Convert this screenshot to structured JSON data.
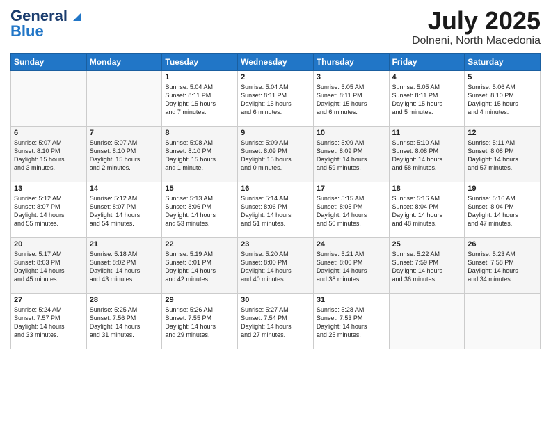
{
  "header": {
    "logo_line1": "General",
    "logo_line2": "Blue",
    "month_year": "July 2025",
    "location": "Dolneni, North Macedonia"
  },
  "days_of_week": [
    "Sunday",
    "Monday",
    "Tuesday",
    "Wednesday",
    "Thursday",
    "Friday",
    "Saturday"
  ],
  "weeks": [
    [
      {
        "day": "",
        "info": ""
      },
      {
        "day": "",
        "info": ""
      },
      {
        "day": "1",
        "info": "Sunrise: 5:04 AM\nSunset: 8:11 PM\nDaylight: 15 hours\nand 7 minutes."
      },
      {
        "day": "2",
        "info": "Sunrise: 5:04 AM\nSunset: 8:11 PM\nDaylight: 15 hours\nand 6 minutes."
      },
      {
        "day": "3",
        "info": "Sunrise: 5:05 AM\nSunset: 8:11 PM\nDaylight: 15 hours\nand 6 minutes."
      },
      {
        "day": "4",
        "info": "Sunrise: 5:05 AM\nSunset: 8:11 PM\nDaylight: 15 hours\nand 5 minutes."
      },
      {
        "day": "5",
        "info": "Sunrise: 5:06 AM\nSunset: 8:10 PM\nDaylight: 15 hours\nand 4 minutes."
      }
    ],
    [
      {
        "day": "6",
        "info": "Sunrise: 5:07 AM\nSunset: 8:10 PM\nDaylight: 15 hours\nand 3 minutes."
      },
      {
        "day": "7",
        "info": "Sunrise: 5:07 AM\nSunset: 8:10 PM\nDaylight: 15 hours\nand 2 minutes."
      },
      {
        "day": "8",
        "info": "Sunrise: 5:08 AM\nSunset: 8:10 PM\nDaylight: 15 hours\nand 1 minute."
      },
      {
        "day": "9",
        "info": "Sunrise: 5:09 AM\nSunset: 8:09 PM\nDaylight: 15 hours\nand 0 minutes."
      },
      {
        "day": "10",
        "info": "Sunrise: 5:09 AM\nSunset: 8:09 PM\nDaylight: 14 hours\nand 59 minutes."
      },
      {
        "day": "11",
        "info": "Sunrise: 5:10 AM\nSunset: 8:08 PM\nDaylight: 14 hours\nand 58 minutes."
      },
      {
        "day": "12",
        "info": "Sunrise: 5:11 AM\nSunset: 8:08 PM\nDaylight: 14 hours\nand 57 minutes."
      }
    ],
    [
      {
        "day": "13",
        "info": "Sunrise: 5:12 AM\nSunset: 8:07 PM\nDaylight: 14 hours\nand 55 minutes."
      },
      {
        "day": "14",
        "info": "Sunrise: 5:12 AM\nSunset: 8:07 PM\nDaylight: 14 hours\nand 54 minutes."
      },
      {
        "day": "15",
        "info": "Sunrise: 5:13 AM\nSunset: 8:06 PM\nDaylight: 14 hours\nand 53 minutes."
      },
      {
        "day": "16",
        "info": "Sunrise: 5:14 AM\nSunset: 8:06 PM\nDaylight: 14 hours\nand 51 minutes."
      },
      {
        "day": "17",
        "info": "Sunrise: 5:15 AM\nSunset: 8:05 PM\nDaylight: 14 hours\nand 50 minutes."
      },
      {
        "day": "18",
        "info": "Sunrise: 5:16 AM\nSunset: 8:04 PM\nDaylight: 14 hours\nand 48 minutes."
      },
      {
        "day": "19",
        "info": "Sunrise: 5:16 AM\nSunset: 8:04 PM\nDaylight: 14 hours\nand 47 minutes."
      }
    ],
    [
      {
        "day": "20",
        "info": "Sunrise: 5:17 AM\nSunset: 8:03 PM\nDaylight: 14 hours\nand 45 minutes."
      },
      {
        "day": "21",
        "info": "Sunrise: 5:18 AM\nSunset: 8:02 PM\nDaylight: 14 hours\nand 43 minutes."
      },
      {
        "day": "22",
        "info": "Sunrise: 5:19 AM\nSunset: 8:01 PM\nDaylight: 14 hours\nand 42 minutes."
      },
      {
        "day": "23",
        "info": "Sunrise: 5:20 AM\nSunset: 8:00 PM\nDaylight: 14 hours\nand 40 minutes."
      },
      {
        "day": "24",
        "info": "Sunrise: 5:21 AM\nSunset: 8:00 PM\nDaylight: 14 hours\nand 38 minutes."
      },
      {
        "day": "25",
        "info": "Sunrise: 5:22 AM\nSunset: 7:59 PM\nDaylight: 14 hours\nand 36 minutes."
      },
      {
        "day": "26",
        "info": "Sunrise: 5:23 AM\nSunset: 7:58 PM\nDaylight: 14 hours\nand 34 minutes."
      }
    ],
    [
      {
        "day": "27",
        "info": "Sunrise: 5:24 AM\nSunset: 7:57 PM\nDaylight: 14 hours\nand 33 minutes."
      },
      {
        "day": "28",
        "info": "Sunrise: 5:25 AM\nSunset: 7:56 PM\nDaylight: 14 hours\nand 31 minutes."
      },
      {
        "day": "29",
        "info": "Sunrise: 5:26 AM\nSunset: 7:55 PM\nDaylight: 14 hours\nand 29 minutes."
      },
      {
        "day": "30",
        "info": "Sunrise: 5:27 AM\nSunset: 7:54 PM\nDaylight: 14 hours\nand 27 minutes."
      },
      {
        "day": "31",
        "info": "Sunrise: 5:28 AM\nSunset: 7:53 PM\nDaylight: 14 hours\nand 25 minutes."
      },
      {
        "day": "",
        "info": ""
      },
      {
        "day": "",
        "info": ""
      }
    ]
  ]
}
